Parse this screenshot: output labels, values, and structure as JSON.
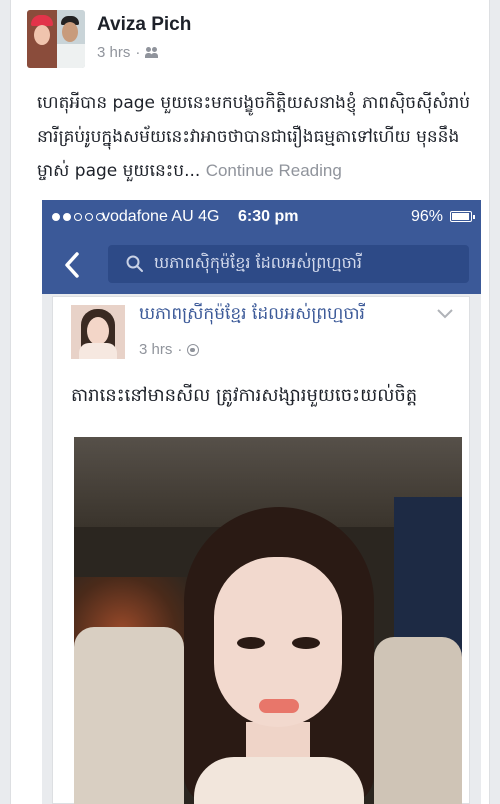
{
  "post": {
    "author": "Aviza Pich",
    "time": "3 hrs",
    "audience_icon": "friends-icon",
    "text": "ហេតុអីបាន page មួយនេះមកបង្ខូចកិត្តិយសនាងខ្ញុំ ភាពស៊ិចស៊ីសំរាប់នារីគ្រប់រូបក្នុងសម័យនេះវាអាចថាបានជារឿងធម្មតាទៅហើយ មុននឹងម្ចាស់ page មួយនេះប...",
    "continue_label": "Continue Reading"
  },
  "screenshot": {
    "status": {
      "carrier": "vodafone AU  4G",
      "time": "6:30 pm",
      "battery": "96%",
      "battery_level": 0.96,
      "signal_dots": 5,
      "signal_dots_filled": 2
    },
    "search": {
      "query": "ឃភាពស៊ិកុម៉ខ្មែរ ដែលអស់ព្រហ្មចារី"
    },
    "inner_post": {
      "page_name": "ឃភាពស្រីកុម៉ខ្មែរ ដែលអស់ព្រហ្មចារី",
      "time": "3 hrs",
      "audience_icon": "globe-icon",
      "text": "តារានេះនៅមានសីល ត្រូវការសង្សារមួយចេះយល់ចិត្ត"
    }
  },
  "colors": {
    "facebook_blue": "#3b5998",
    "text": "#1d2129",
    "muted": "#90949c"
  }
}
